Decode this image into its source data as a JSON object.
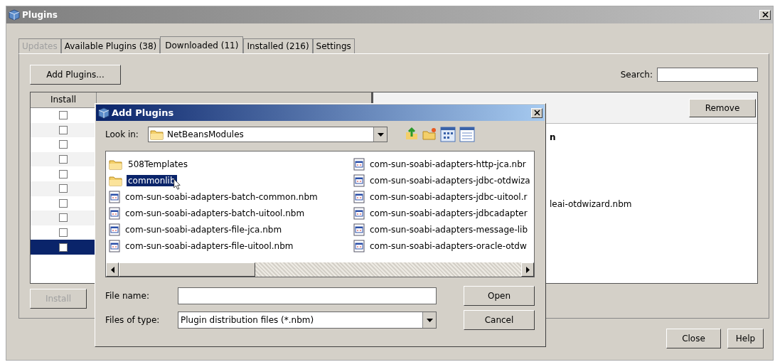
{
  "window": {
    "title": "Plugins"
  },
  "tabs": [
    {
      "label": "Updates",
      "selected": false,
      "disabled": true
    },
    {
      "label": "Available Plugins (38)",
      "selected": false,
      "disabled": false
    },
    {
      "label": "Downloaded (11)",
      "selected": true,
      "disabled": false
    },
    {
      "label": "Installed (216)",
      "selected": false,
      "disabled": false
    },
    {
      "label": "Settings",
      "selected": false,
      "disabled": false
    }
  ],
  "add_button": "Add Plugins...",
  "search": {
    "label": "Search:"
  },
  "table": {
    "columns": [
      "Install"
    ],
    "rows": [
      {
        "checked": false,
        "selected": false
      },
      {
        "checked": false,
        "selected": false
      },
      {
        "checked": false,
        "selected": false
      },
      {
        "checked": false,
        "selected": false
      },
      {
        "checked": false,
        "selected": false
      },
      {
        "checked": false,
        "selected": false
      },
      {
        "checked": false,
        "selected": false
      },
      {
        "checked": false,
        "selected": false
      },
      {
        "checked": false,
        "selected": false
      },
      {
        "checked": false,
        "selected": true
      }
    ]
  },
  "details": {
    "button": "Remove",
    "lines": [
      "n",
      "leai-otdwizard.nbm"
    ]
  },
  "install_button": {
    "label": "Install",
    "disabled": true
  },
  "footer_buttons": [
    "Close",
    "Help"
  ],
  "dialog": {
    "title": "Add Plugins",
    "look_in_label": "Look in:",
    "look_in_value": "NetBeansModules",
    "files": [
      {
        "name": "508Templates",
        "kind": "folder",
        "selected": false
      },
      {
        "name": "commonlib",
        "kind": "folder",
        "selected": true
      },
      {
        "name": "com-sun-soabi-adapters-batch-common.nbm",
        "kind": "file",
        "selected": false
      },
      {
        "name": "com-sun-soabi-adapters-batch-uitool.nbm",
        "kind": "file",
        "selected": false
      },
      {
        "name": "com-sun-soabi-adapters-file-jca.nbm",
        "kind": "file",
        "selected": false
      },
      {
        "name": "com-sun-soabi-adapters-file-uitool.nbm",
        "kind": "file",
        "selected": false
      },
      {
        "name": "com-sun-soabi-adapters-http-jca.nbr",
        "kind": "file",
        "selected": false
      },
      {
        "name": "com-sun-soabi-adapters-jdbc-otdwiza",
        "kind": "file",
        "selected": false
      },
      {
        "name": "com-sun-soabi-adapters-jdbc-uitool.r",
        "kind": "file",
        "selected": false
      },
      {
        "name": "com-sun-soabi-adapters-jdbcadapter",
        "kind": "file",
        "selected": false
      },
      {
        "name": "com-sun-soabi-adapters-message-lib",
        "kind": "file",
        "selected": false
      },
      {
        "name": "com-sun-soabi-adapters-oracle-otdw",
        "kind": "file",
        "selected": false
      }
    ],
    "file_name_label": "File name:",
    "file_type_label": "Files of type:",
    "file_type_value": "Plugin distribution files (*.nbm)",
    "buttons": [
      "Open",
      "Cancel"
    ]
  }
}
